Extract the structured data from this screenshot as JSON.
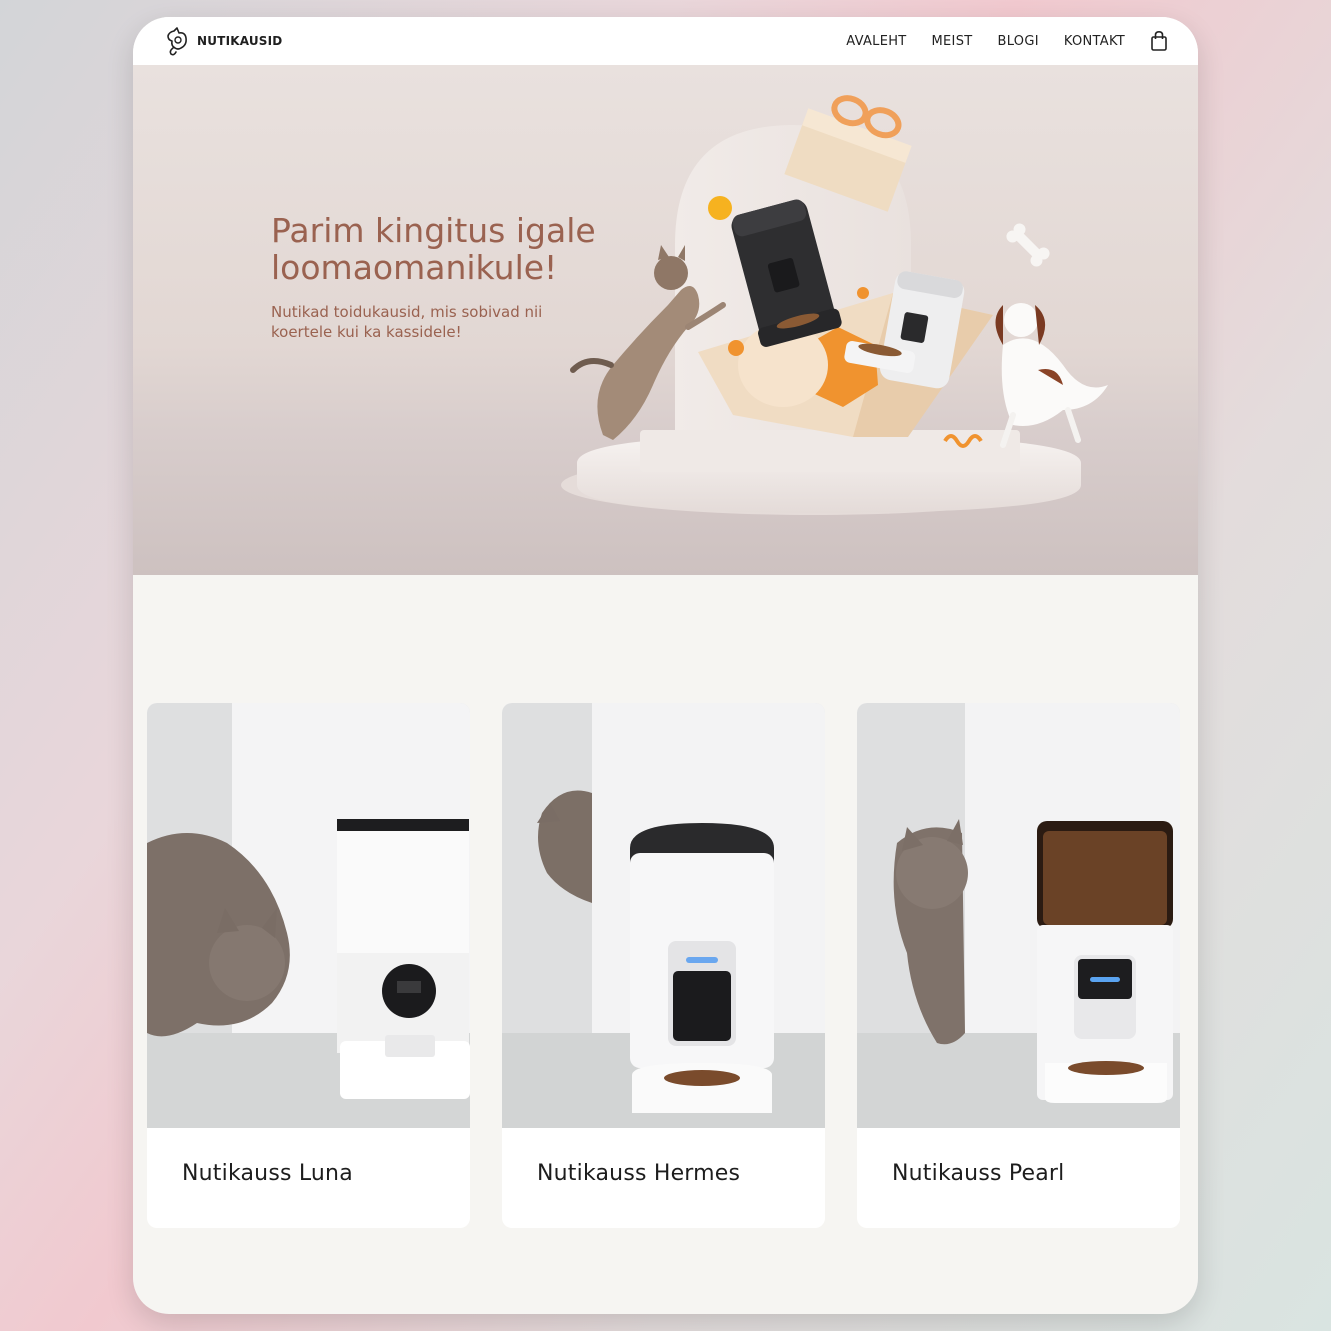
{
  "brand": {
    "name": "NUTIKAUSID"
  },
  "nav": {
    "items": [
      {
        "label": "AVALEHT"
      },
      {
        "label": "MEIST"
      },
      {
        "label": "BLOGI"
      },
      {
        "label": "KONTAKT"
      }
    ]
  },
  "hero": {
    "title": "Parim kingitus igale loomaomanikule!",
    "subtitle": "Nutikad toidukausid, mis sobivad nii koertele kui ka kassidele!"
  },
  "products": [
    {
      "name": "Nutikauss Luna"
    },
    {
      "name": "Nutikauss Hermes"
    },
    {
      "name": "Nutikauss Pearl"
    }
  ],
  "colors": {
    "accent": "#9a6250",
    "orange": "#f0932f",
    "page_bg": "#f6f5f2"
  }
}
